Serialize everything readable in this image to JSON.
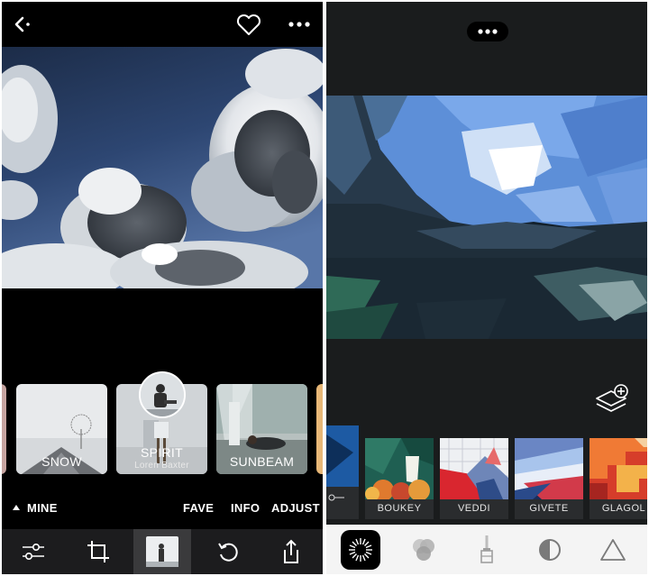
{
  "left": {
    "topbar": {
      "back_icon": "chevron-left-icon",
      "favorite_icon": "heart-icon",
      "more_icon": "ellipsis-icon"
    },
    "filters": [
      {
        "name": "SNOW",
        "author": ""
      },
      {
        "name": "SPIRIT",
        "author": "Loren Baxter"
      },
      {
        "name": "SUNBEAM",
        "author": ""
      }
    ],
    "tabs": {
      "mine": "MINE",
      "fave": "FAVE",
      "info": "INFO",
      "adjust": "ADJUST"
    },
    "toolbar": [
      "sliders-icon",
      "crop-icon",
      "filter-thumbnail",
      "rotate-icon",
      "share-icon"
    ]
  },
  "right": {
    "more_icon": "ellipsis-icon",
    "layers_icon": "add-layer-icon",
    "presets": [
      {
        "name": "BOUKEY"
      },
      {
        "name": "VEDDI"
      },
      {
        "name": "GIVETE"
      },
      {
        "name": "GLAGOL"
      }
    ],
    "toolbar": [
      "starburst-icon",
      "color-circles-icon",
      "brush-icon",
      "contrast-icon",
      "triangle-icon"
    ]
  },
  "colors": {
    "left_bg": "#000000",
    "right_bg": "#1a1c1d",
    "toolbar_dark": "#1c1c1e",
    "toolbar_light": "#f4f4f4",
    "text_light": "#ffffff"
  }
}
